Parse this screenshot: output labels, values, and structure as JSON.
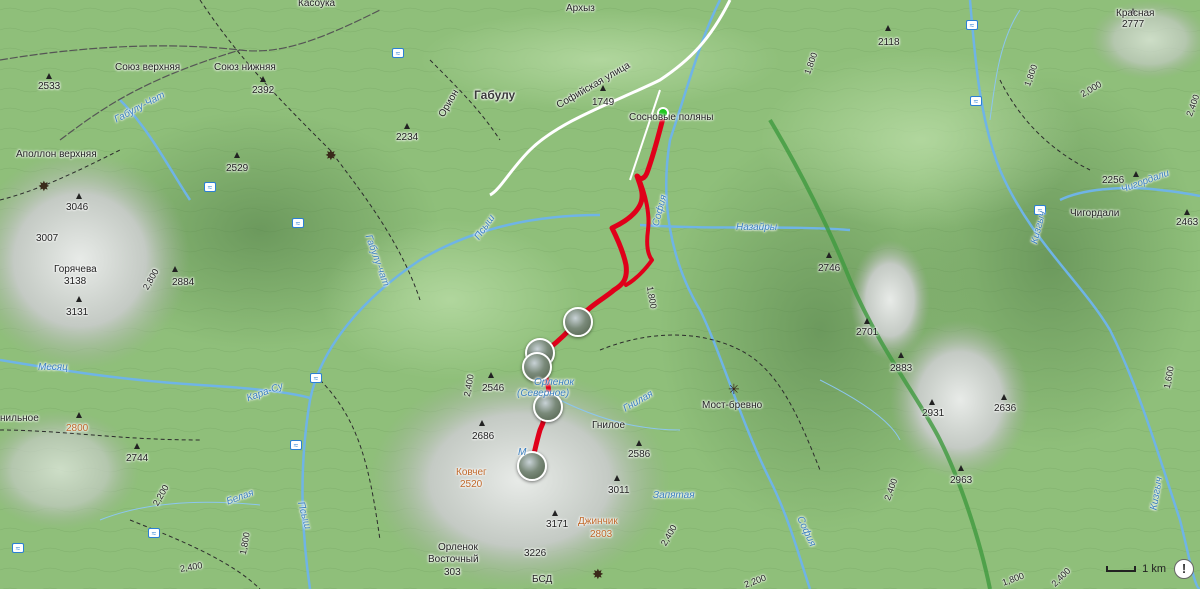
{
  "map": {
    "labels": {
      "arkhyz": "Архыз",
      "kasovka": "Касоука",
      "soyuz_upper": "Союз верхняя",
      "soyuz_lower": "Союз нижняя",
      "apollon_upper": "Аполлон верхняя",
      "gabulu": "Габулу",
      "gabulu_river": "Габулу-Чат",
      "gabulu_river2": "Габулу-чат",
      "sofiyskaya_street": "Софийская улица",
      "sosnovye_polyany": "Сосновые поляны",
      "orion": "Орион",
      "psysh": "Псыш",
      "psysh2": "Псыш",
      "sofiya": "София",
      "sofiya2": "София",
      "nazairy": "Назайры",
      "goryacheva": "Горячева",
      "mesyats": "Месяц",
      "karasu": "Кара-Су",
      "belaya": "Белая",
      "gniloe": "Гнилое",
      "gnilaya": "Гнилая",
      "most_brevno": "Мост-бревно",
      "zapyataya": "Запятая",
      "kovcheg": "Ковчег",
      "dzhinchik": "Джинчик",
      "orlenok_north": "Орленок",
      "orlenok_north2": "(Северное)",
      "orlenok_east": "Орленок",
      "orlenok_east2": "Восточный",
      "bsd": "БСД",
      "krasnaya": "Красная",
      "chigordali": "Чигордали",
      "chigordali_river": "Чигордали",
      "kizgich": "Кизгыч",
      "kizgich2": "Кизгыч",
      "nilnoe": "нильное",
      "marker_m": "М"
    },
    "elevations": {
      "e2533": "2533",
      "e2392": "2392",
      "e2529": "2529",
      "e2234": "2234",
      "e1749": "1749",
      "e2118": "2118",
      "e2777": "2777",
      "e3046": "3046",
      "e3007": "3007",
      "e3138": "3138",
      "e3131": "3131",
      "e2884": "2884",
      "e2746": "2746",
      "e2701": "2701",
      "e2883": "2883",
      "e2256": "2256",
      "e2463": "2463",
      "e2546": "2546",
      "e2686": "2686",
      "e2586": "2586",
      "e3011": "3011",
      "e2520": "2520",
      "e3171": "3171",
      "e2803": "2803",
      "e3226": "3226",
      "e303": "303",
      "e2931": "2931",
      "e2636": "2636",
      "e2963": "2963",
      "e2744": "2744",
      "e2800": "2800",
      "e2320": "2320"
    },
    "contours": {
      "c1800a": "1,800",
      "c1800b": "1,800",
      "c1800c": "1,800",
      "c1800d": "1,800",
      "c2000": "2,000",
      "c2400a": "2,400",
      "c2400b": "2,400",
      "c2400c": "2,400",
      "c2400d": "2,400",
      "c2400e": "2,400",
      "c2200a": "2,200",
      "c2200b": "2,200",
      "c2800": "2,800",
      "c1600": "1,600",
      "c2400f": "2,400",
      "c1800e": "1,800"
    },
    "scale_label": "1 km",
    "info_label": "!",
    "colors": {
      "terrain": "#8fbf7a",
      "route": "#e0001a",
      "river": "#6fb4e6",
      "ridge_trail": "#3f9a3f",
      "road": "#ffffff",
      "start": "#1ec81e"
    }
  }
}
